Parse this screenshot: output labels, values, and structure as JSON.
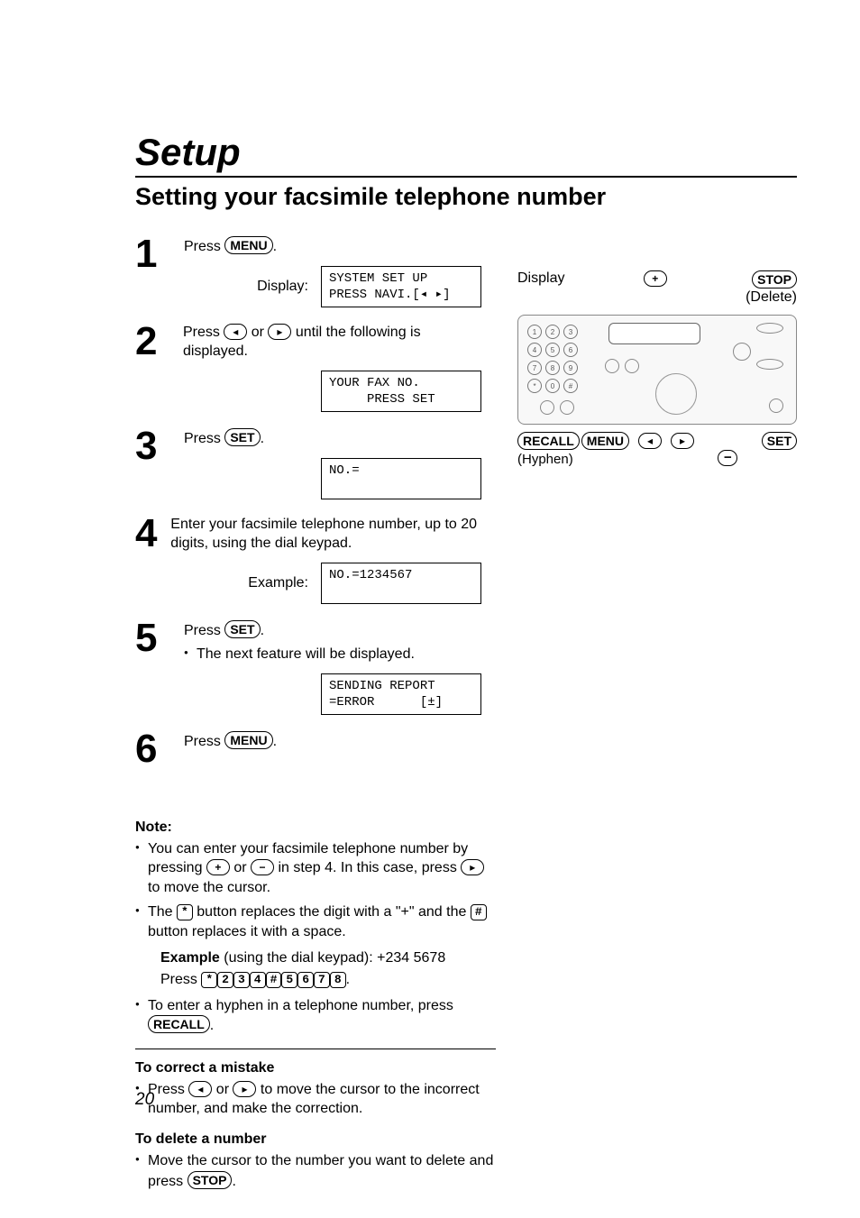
{
  "title": "Setup",
  "subtitle": "Setting your facsimile telephone number",
  "steps": {
    "s1": {
      "num": "1",
      "text_before": "Press ",
      "btn": "MENU",
      "text_after": ".",
      "lcd_label": "Display:",
      "lcd": "SYSTEM SET UP\nPRESS NAVI.[◂ ▸]"
    },
    "s2": {
      "num": "2",
      "text_before": "Press ",
      "arrow1": "◂",
      "text_mid": " or ",
      "arrow2": "▸",
      "text_after": " until the following is displayed.",
      "lcd": "YOUR FAX NO.\n     PRESS SET"
    },
    "s3": {
      "num": "3",
      "text_before": "Press ",
      "btn": "SET",
      "text_after": ".",
      "lcd": "NO.=\n "
    },
    "s4": {
      "num": "4",
      "text": "Enter your facsimile telephone number, up to 20 digits, using the dial keypad.",
      "lcd_label": "Example:",
      "lcd": "NO.=1234567\n "
    },
    "s5": {
      "num": "5",
      "text_before": "Press ",
      "btn": "SET",
      "text_after": ".",
      "sub_bullet": "The next feature will be displayed.",
      "lcd": "SENDING REPORT\n=ERROR      [±]"
    },
    "s6": {
      "num": "6",
      "text_before": "Press ",
      "btn": "MENU",
      "text_after": "."
    }
  },
  "right": {
    "display_label": "Display",
    "plus": "+",
    "stop": "STOP",
    "delete": "(Delete)",
    "recall": "RECALL",
    "menu": "MENU",
    "left_arrow": "◂",
    "right_arrow": "▸",
    "set": "SET",
    "hyphen": "(Hyphen)",
    "minus": "−",
    "keypad": [
      "1",
      "2",
      "3",
      "4",
      "5",
      "6",
      "7",
      "8",
      "9",
      "*",
      "0",
      "#"
    ]
  },
  "note_heading": "Note:",
  "note_items": {
    "n1": {
      "a": "You can enter your facsimile telephone number by pressing ",
      "plus": "+",
      "b": " or ",
      "minus": "−",
      "c": " in step 4. In this case, press ",
      "right": "▸",
      "d": " to move the cursor."
    },
    "n2": {
      "a": "The ",
      "star": "*",
      "b": " button replaces the digit with a \"+\" and the ",
      "hash": "#",
      "c": " button replaces it with a space."
    },
    "example_label": "Example",
    "example_text": " (using the dial keypad):   +234   5678",
    "press_label": "Press ",
    "press_keys": [
      "*",
      "2",
      "3",
      "4",
      "#",
      "5",
      "6",
      "7",
      "8"
    ],
    "press_after": ".",
    "n3": {
      "a": "To enter a hyphen in a telephone number, press ",
      "recall": "RECALL",
      "b": "."
    }
  },
  "correct_heading": "To correct a mistake",
  "correct": {
    "a": "Press ",
    "left": "◂",
    "b": " or ",
    "right": "▸",
    "c": " to move the cursor to the incorrect number, and make the correction."
  },
  "delete_heading": "To delete a number",
  "delete": {
    "a": "Move the cursor to the number you want to delete and press ",
    "stop": "STOP",
    "b": "."
  },
  "page_number": "20"
}
